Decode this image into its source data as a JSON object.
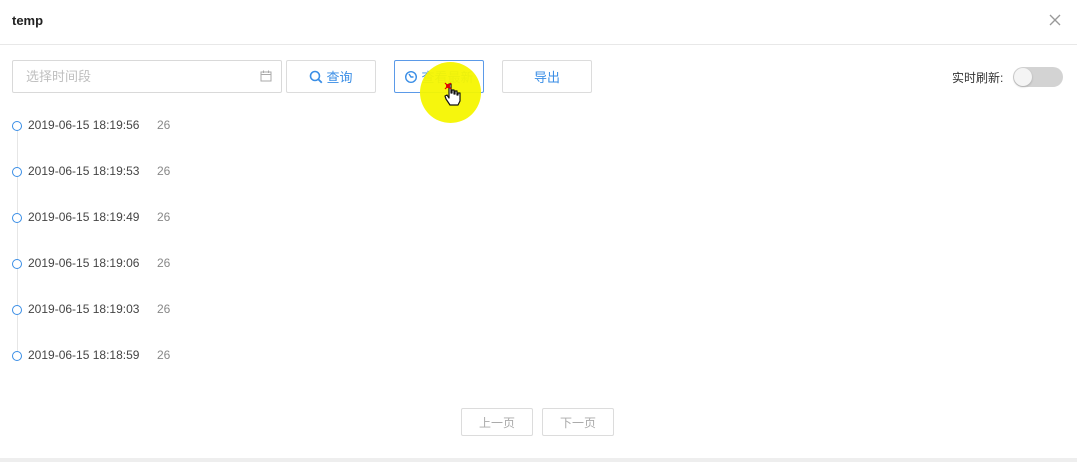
{
  "dialog": {
    "title": "temp"
  },
  "toolbar": {
    "date_placeholder": "选择时间段",
    "query_label": "查询",
    "latest_label": "查看最新",
    "export_label": "导出",
    "realtime_label": "实时刷新:",
    "realtime_on": false
  },
  "timeline": {
    "items": [
      {
        "time": "2019-06-15 18:19:56",
        "value": "26"
      },
      {
        "time": "2019-06-15 18:19:53",
        "value": "26"
      },
      {
        "time": "2019-06-15 18:19:49",
        "value": "26"
      },
      {
        "time": "2019-06-15 18:19:06",
        "value": "26"
      },
      {
        "time": "2019-06-15 18:19:03",
        "value": "26"
      },
      {
        "time": "2019-06-15 18:18:59",
        "value": "26"
      }
    ]
  },
  "pager": {
    "prev_label": "上一页",
    "next_label": "下一页"
  },
  "colors": {
    "accent": "#3a8ee6",
    "cursor_highlight": "#f5f500"
  },
  "icons": {
    "close": "close-icon",
    "calendar": "calendar-icon",
    "search": "search-icon",
    "refresh": "refresh-icon"
  }
}
